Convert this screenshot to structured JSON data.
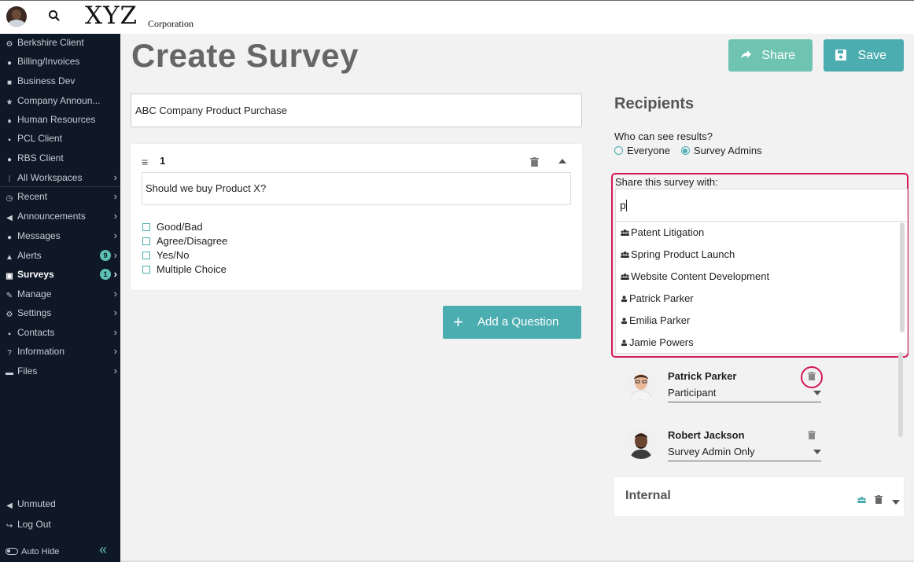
{
  "header": {
    "logo_main": "XYZ",
    "logo_sub": "Corporation"
  },
  "sidebar": {
    "items": [
      {
        "label": "Berkshire Client",
        "icon": "gear-icon"
      },
      {
        "label": "Billing/Invoices",
        "icon": "globe-icon"
      },
      {
        "label": "Business Dev",
        "icon": "users-icon"
      },
      {
        "label": "Company Announ...",
        "icon": "star-icon"
      },
      {
        "label": "Human Resources",
        "icon": "pin-icon"
      },
      {
        "label": "PCL Client",
        "icon": "briefcase-icon"
      },
      {
        "label": "RBS Client",
        "icon": "globe-icon"
      },
      {
        "label": "All Workspaces",
        "icon": "grid-icon"
      },
      {
        "label": "Recent",
        "icon": "clock-icon"
      },
      {
        "label": "Announcements",
        "icon": "megaphone-icon"
      },
      {
        "label": "Messages",
        "icon": "chat-icon"
      },
      {
        "label": "Alerts",
        "icon": "warning-icon",
        "badge": "9"
      },
      {
        "label": "Surveys",
        "icon": "clipboard-icon",
        "badge": "1"
      },
      {
        "label": "Manage",
        "icon": "pencil-icon"
      },
      {
        "label": "Settings",
        "icon": "gear-icon"
      },
      {
        "label": "Contacts",
        "icon": "contact-card-icon"
      },
      {
        "label": "Information",
        "icon": "question-icon"
      },
      {
        "label": "Files",
        "icon": "folder-icon"
      }
    ],
    "footer": {
      "unmuted": "Unmuted",
      "logout": "Log Out",
      "autohide": "Auto Hide"
    }
  },
  "main": {
    "page_title": "Create Survey",
    "share_button": "Share",
    "save_button": "Save",
    "survey_title_value": "ABC Company Product Purchase",
    "question": {
      "number": "1",
      "text": "Should we buy Product X?",
      "options": [
        "Good/Bad",
        "Agree/Disagree",
        "Yes/No",
        "Multiple Choice"
      ]
    },
    "add_question_button": "Add a Question"
  },
  "recipients": {
    "title": "Recipients",
    "who_label": "Who can see results?",
    "radio_options": [
      "Everyone",
      "Survey Admins"
    ],
    "selected_radio": "Survey Admins",
    "share_label": "Share this survey with:",
    "share_input_value": "p",
    "suggestions": [
      {
        "label": "Patent Litigation",
        "icon": "group-icon"
      },
      {
        "label": "Spring Product Launch",
        "icon": "group-icon"
      },
      {
        "label": "Website Content Development",
        "icon": "group-icon"
      },
      {
        "label": "Patrick Parker",
        "icon": "person-icon"
      },
      {
        "label": "Emilia Parker",
        "icon": "person-icon"
      },
      {
        "label": "Jamie Powers",
        "icon": "person-icon"
      }
    ],
    "list": [
      {
        "name": "Patrick Parker",
        "role": "Participant"
      },
      {
        "name": "Robert Jackson",
        "role": "Survey Admin Only"
      }
    ],
    "internal_title": "Internal"
  },
  "colors": {
    "sidebar_bg": "#0f1827",
    "accent_teal": "#4cadb0",
    "share_green": "#6fc4b1",
    "highlight_pink": "#d4175a"
  }
}
